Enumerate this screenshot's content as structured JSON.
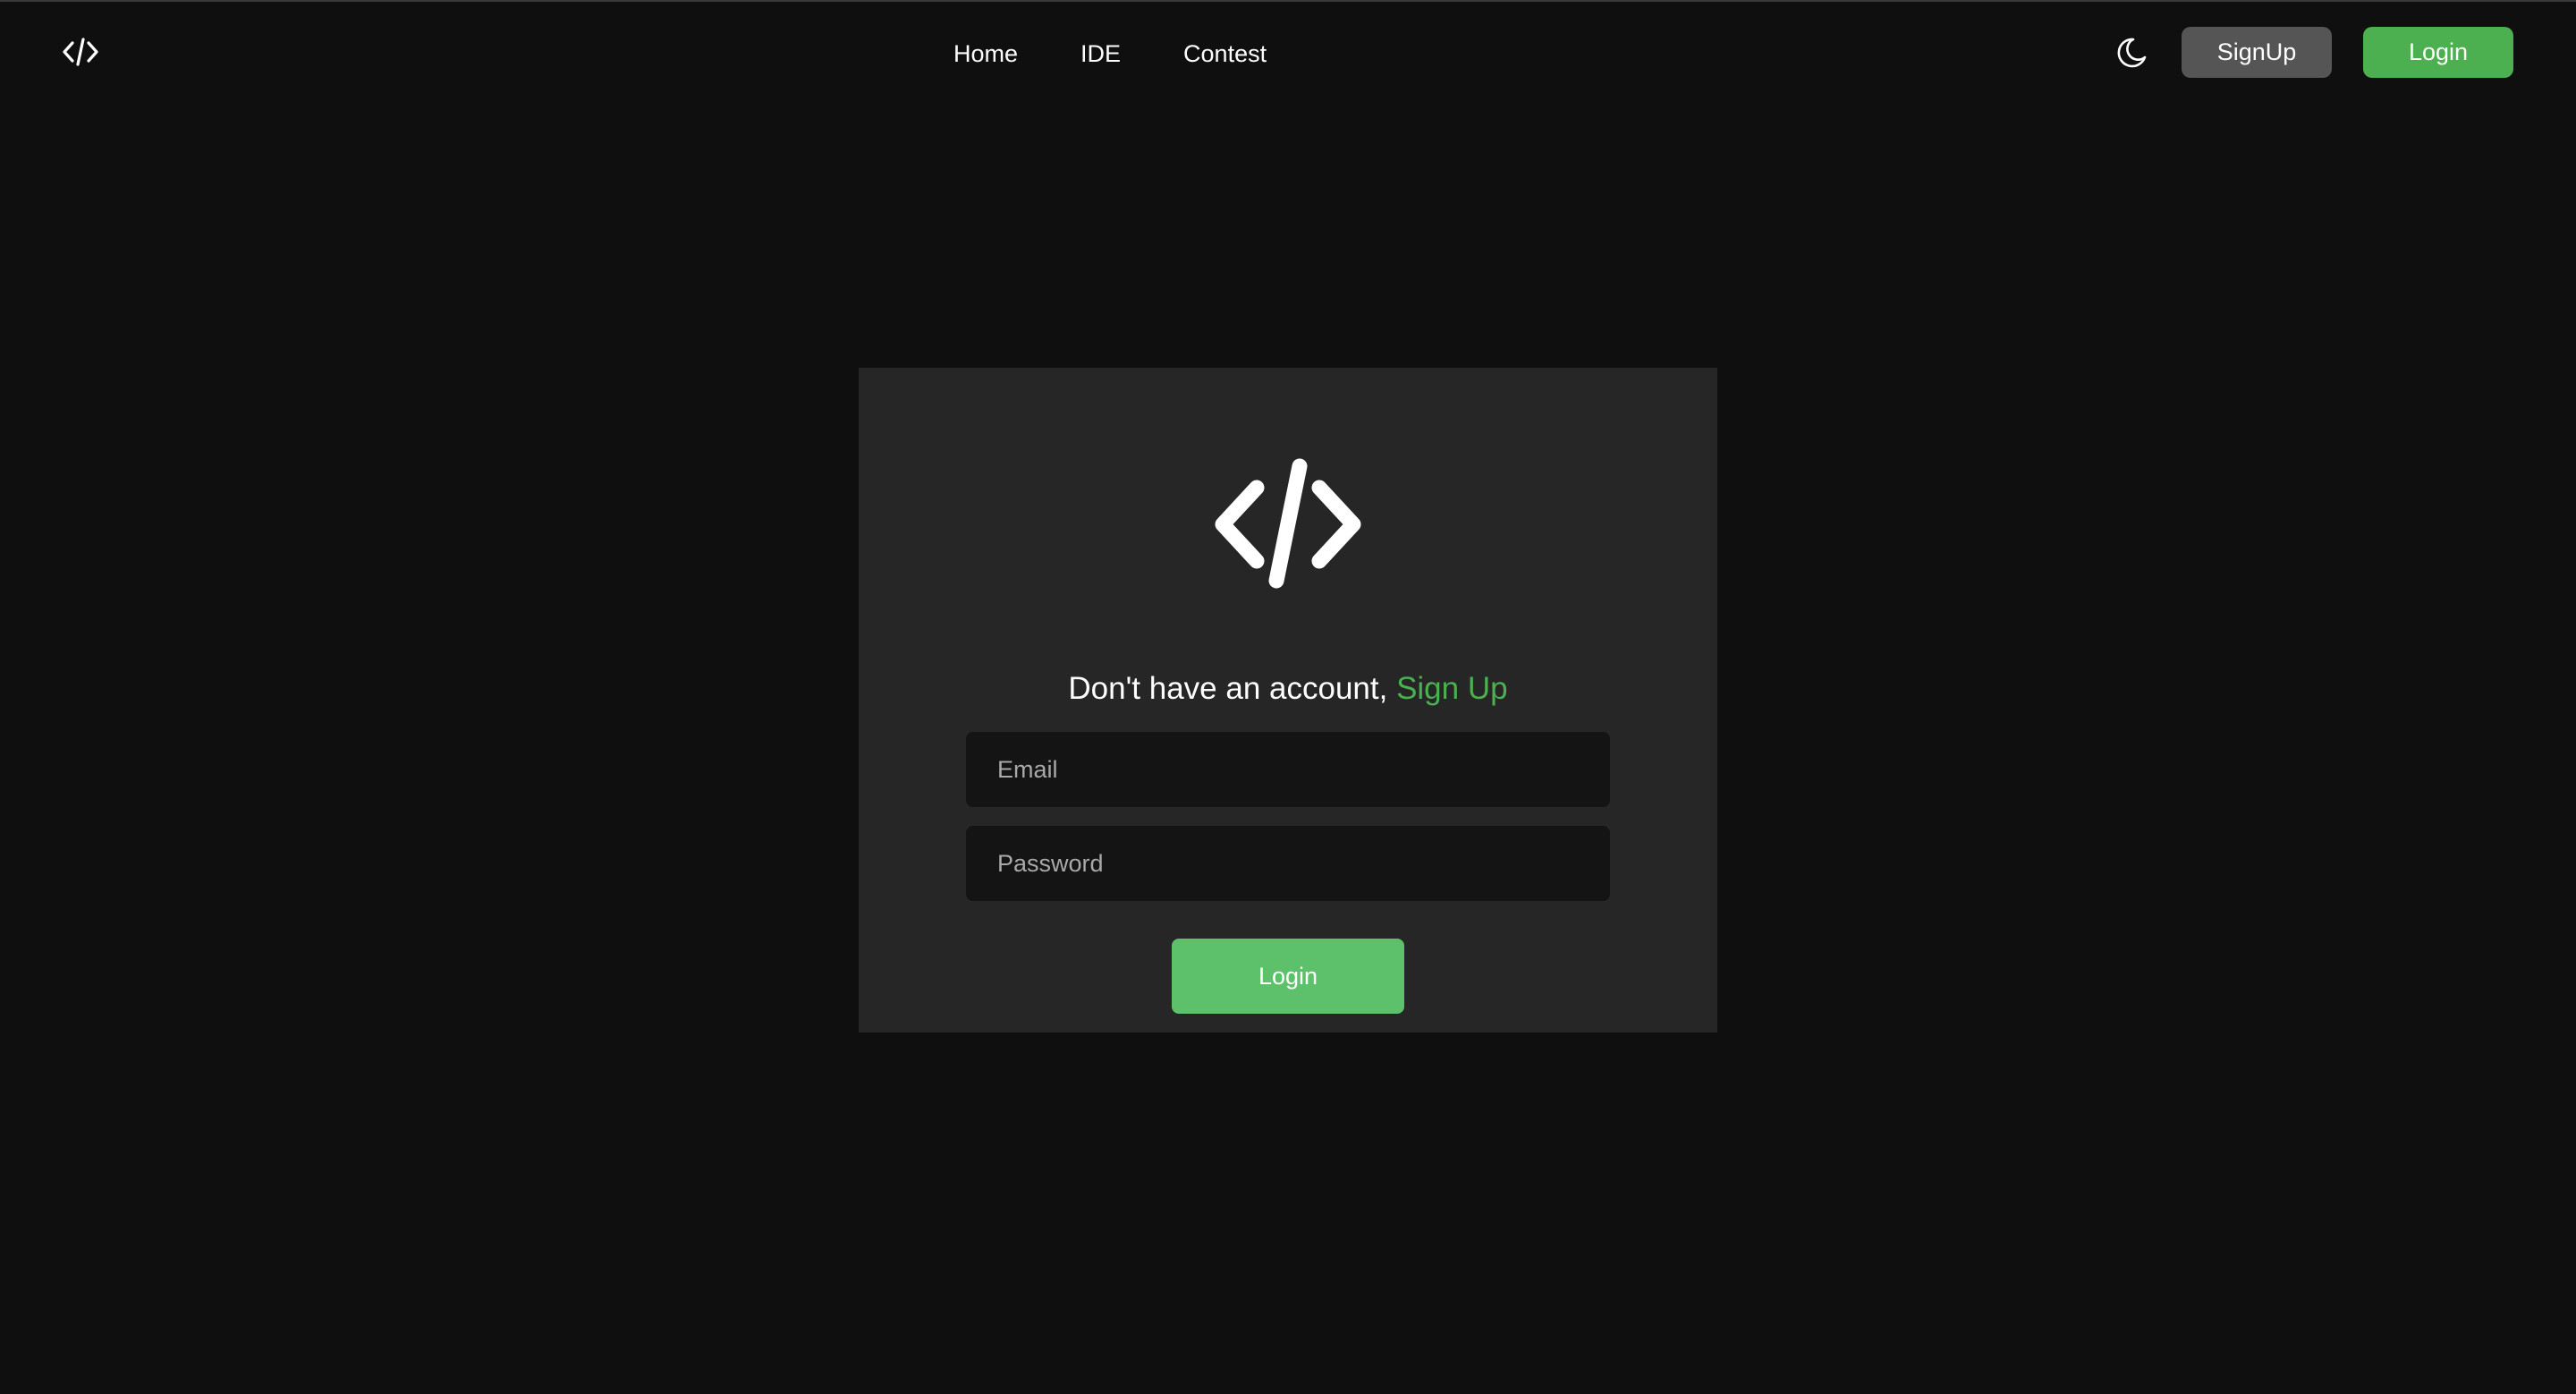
{
  "navbar": {
    "logo_icon": "code-icon",
    "links": [
      {
        "label": "Home"
      },
      {
        "label": "IDE"
      },
      {
        "label": "Contest"
      }
    ],
    "theme_icon": "moon-icon",
    "signup_label": "SignUp",
    "login_label": "Login"
  },
  "login_card": {
    "logo_icon": "code-icon",
    "prompt_text": "Don't have an account, ",
    "signup_link": "Sign Up",
    "email_placeholder": "Email",
    "email_value": "",
    "password_placeholder": "Password",
    "password_value": "",
    "submit_label": "Login"
  },
  "colors": {
    "background": "#0f0f0f",
    "card": "#262626",
    "accent_green": "#4caf50",
    "button_green": "#5cc16a",
    "signup_button": "#555555",
    "input_background": "#141414"
  }
}
